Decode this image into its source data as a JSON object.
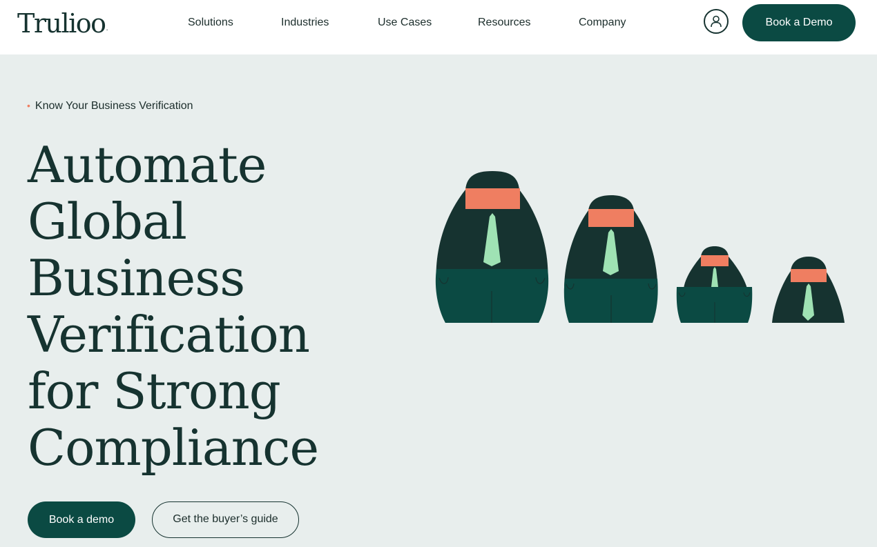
{
  "brand": {
    "logo_text": "Trulioo",
    "logo_mark": "."
  },
  "nav": {
    "items": [
      {
        "label": "Solutions"
      },
      {
        "label": "Industries"
      },
      {
        "label": "Use Cases"
      },
      {
        "label": "Resources"
      },
      {
        "label": "Company"
      }
    ],
    "account_icon": "user-icon",
    "cta_label": "Book a Demo"
  },
  "hero": {
    "eyebrow": "Know Your Business Verification",
    "headline_lines": [
      "Automate",
      "Global",
      "Business",
      "Verification",
      "for Strong",
      "Compliance"
    ],
    "primary_cta": "Book a demo",
    "secondary_cta": "Get the buyer’s guide",
    "illustration": "nesting-doll-businesspeople-illustration"
  },
  "colors": {
    "accent_green": "#0b4a43",
    "dark_text": "#163330",
    "hero_bg": "#e8eeed",
    "face_coral": "#ef7e61",
    "tie_mint": "#9fe2b4"
  }
}
